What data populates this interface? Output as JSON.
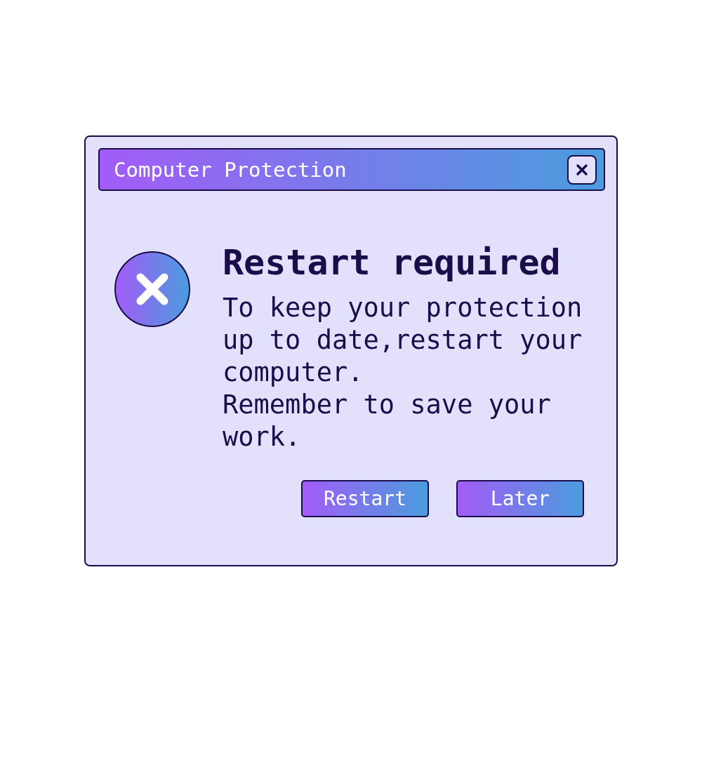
{
  "window": {
    "title": "Computer Protection"
  },
  "heading": "Restart required",
  "message": [
    "To keep your protection up to date,restart your computer.",
    "Remember to save your work."
  ],
  "buttons": [
    {
      "label": "Restart"
    },
    {
      "label": "Later"
    }
  ]
}
